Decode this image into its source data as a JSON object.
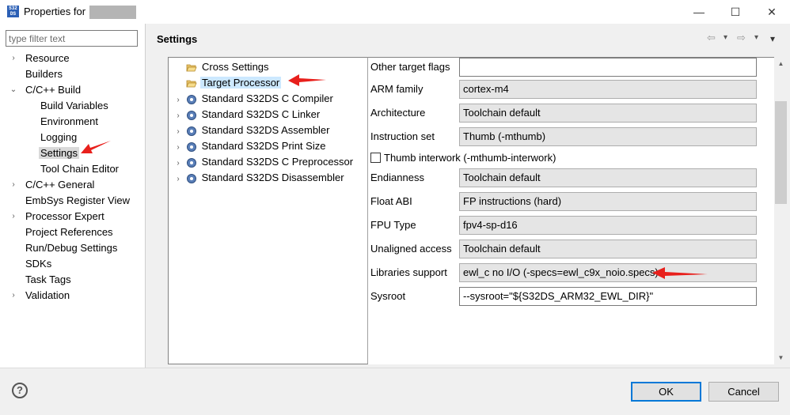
{
  "window": {
    "title": "Properties for",
    "icon_text": "S32\nDS",
    "minimize": "—",
    "maximize": "☐",
    "close": "✕"
  },
  "filter": {
    "placeholder": "type filter text"
  },
  "nav": {
    "items": [
      {
        "label": "Resource",
        "twisty": "›"
      },
      {
        "label": "Builders",
        "twisty": ""
      },
      {
        "label": "C/C++ Build",
        "twisty": "⌄"
      },
      {
        "label": "Build Variables",
        "twisty": ""
      },
      {
        "label": "Environment",
        "twisty": ""
      },
      {
        "label": "Logging",
        "twisty": ""
      },
      {
        "label": "Settings",
        "twisty": ""
      },
      {
        "label": "Tool Chain Editor",
        "twisty": ""
      },
      {
        "label": "C/C++ General",
        "twisty": "›"
      },
      {
        "label": "EmbSys Register View",
        "twisty": ""
      },
      {
        "label": "Processor Expert",
        "twisty": "›"
      },
      {
        "label": "Project References",
        "twisty": ""
      },
      {
        "label": "Run/Debug Settings",
        "twisty": ""
      },
      {
        "label": "SDKs",
        "twisty": ""
      },
      {
        "label": "Task Tags",
        "twisty": ""
      },
      {
        "label": "Validation",
        "twisty": "›"
      }
    ]
  },
  "page": {
    "title": "Settings",
    "back_icon": "⇦",
    "back_menu": "▾",
    "forward_icon": "⇨",
    "forward_menu": "▾",
    "view_menu": "▾"
  },
  "tools": {
    "items": [
      {
        "label": "Cross Settings",
        "twisty": ""
      },
      {
        "label": "Target Processor",
        "twisty": ""
      },
      {
        "label": "Standard S32DS C Compiler",
        "twisty": "›"
      },
      {
        "label": "Standard S32DS C Linker",
        "twisty": "›"
      },
      {
        "label": "Standard S32DS Assembler",
        "twisty": "›"
      },
      {
        "label": "Standard S32DS Print Size",
        "twisty": "›"
      },
      {
        "label": "Standard S32DS C Preprocessor",
        "twisty": "›"
      },
      {
        "label": "Standard S32DS Disassembler",
        "twisty": "›"
      }
    ]
  },
  "options": {
    "other_flags": {
      "label": "Other target flags",
      "value": ""
    },
    "arm_family": {
      "label": "ARM family",
      "value": "cortex-m4"
    },
    "architecture": {
      "label": "Architecture",
      "value": "Toolchain default"
    },
    "instruction_set": {
      "label": "Instruction set",
      "value": "Thumb (-mthumb)"
    },
    "thumb_interwork": {
      "label": "Thumb interwork (-mthumb-interwork)",
      "checked": false
    },
    "endianness": {
      "label": "Endianness",
      "value": "Toolchain default"
    },
    "float_abi": {
      "label": "Float ABI",
      "value": "FP instructions (hard)"
    },
    "fpu_type": {
      "label": "FPU Type",
      "value": "fpv4-sp-d16"
    },
    "unaligned_access": {
      "label": "Unaligned access",
      "value": "Toolchain default"
    },
    "libraries_support": {
      "label": "Libraries support",
      "value": "ewl_c no I/O (-specs=ewl_c9x_noio.specs)"
    },
    "sysroot": {
      "label": "Sysroot",
      "value": "--sysroot=\"${S32DS_ARM32_EWL_DIR}\""
    }
  },
  "scrollbar": {
    "up": "▲",
    "down": "▼"
  },
  "buttons": {
    "help": "?",
    "ok": "OK",
    "cancel": "Cancel"
  },
  "colors": {
    "annotation_arrow": "#e8201c",
    "selection": "#cce8ff",
    "default_button_border": "#0078d7"
  }
}
